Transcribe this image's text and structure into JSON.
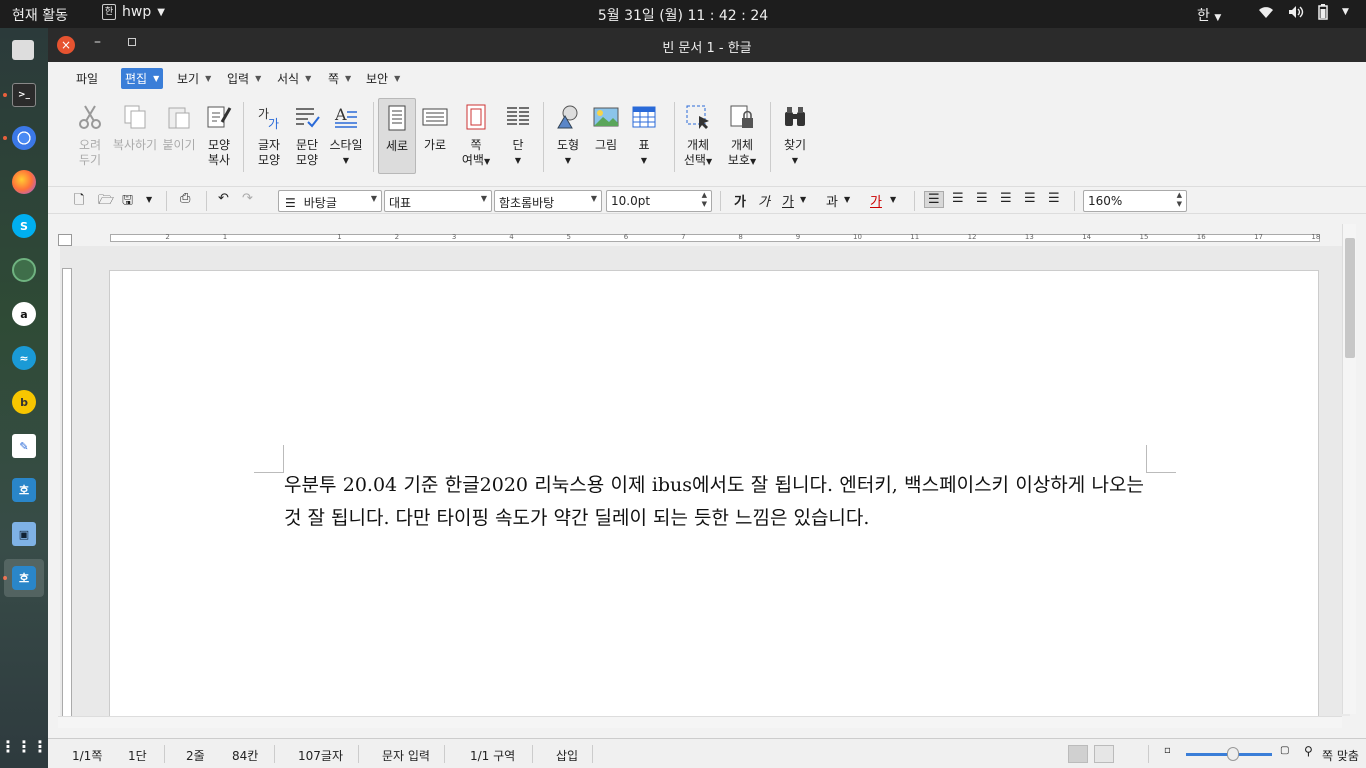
{
  "topbar": {
    "activities": "현재 활동",
    "app_name": "hwp",
    "app_icon": "한",
    "clock": "5월 31일 (월)  11 : 42 : 24",
    "ime": "한",
    "icons": [
      "wifi-icon",
      "volume-icon",
      "battery-icon",
      "power-menu-icon"
    ]
  },
  "dock": {
    "items": [
      "files",
      "terminal",
      "chrome",
      "firefox",
      "skype",
      "atom",
      "amazon",
      "app",
      "bandizip",
      "text-editor",
      "hancom-office",
      "virtualbox",
      "hwp"
    ],
    "show_apps_icon": "grid-icon"
  },
  "window": {
    "title": "빈 문서 1 - 한글",
    "close": "×",
    "minimize": "–"
  },
  "menu": {
    "items": [
      {
        "label": "파일"
      },
      {
        "label": "편집"
      },
      {
        "label": "보기"
      },
      {
        "label": "입력"
      },
      {
        "label": "서식"
      },
      {
        "label": "쪽"
      },
      {
        "label": "보안"
      }
    ]
  },
  "ribbon": {
    "cut": [
      "오려",
      "두기"
    ],
    "copy": "복사하기",
    "paste": "붙이기",
    "format_copy": [
      "모양",
      "복사"
    ],
    "char_shape": [
      "글자",
      "모양"
    ],
    "para_shape": [
      "문단",
      "모양"
    ],
    "style": "스타일",
    "portrait": "세로",
    "landscape": "가로",
    "page_margin": [
      "쪽",
      "여백"
    ],
    "columns": "단",
    "shape": "도형",
    "picture": "그림",
    "table": "표",
    "select_object": [
      "개체",
      "선택"
    ],
    "protect_object": [
      "개체",
      "보호"
    ],
    "find": "찾기"
  },
  "toolbar2": {
    "style_value": "바탕글",
    "lang_value": "대표",
    "font_value": "함초롬바탕",
    "size_value": "10.0pt",
    "bold": "가",
    "italic": "가",
    "underline": "가",
    "strike": "과",
    "color": "가",
    "zoom_value": "160%"
  },
  "ruler": {
    "ticks": [
      "2",
      "1",
      "1",
      "2",
      "3",
      "4",
      "5",
      "6",
      "7",
      "8",
      "9",
      "10",
      "11",
      "12",
      "13",
      "14",
      "15",
      "16",
      "17",
      "18"
    ]
  },
  "document": {
    "text": "우분투 20.04 기준 한글2020 리눅스용 이제 ibus에서도 잘 됩니다. 엔터키, 백스페이스키 이상하게 나오는 것 잘 됩니다. 다만 타이핑 속도가 약간 딜레이 되는 듯한 느낌은 있습니다."
  },
  "status": {
    "page": "1/1쪽",
    "column": "1단",
    "line": "2줄",
    "col_pos": "84칸",
    "chars": "107글자",
    "mode": "문자 입력",
    "section": "1/1 구역",
    "insert": "삽입",
    "fit": "쪽 맞춤"
  },
  "colors": {
    "accent": "#3a7ed8",
    "close": "#e65330",
    "topbar": "#1d1d1d",
    "titlebar": "#2b2b2b"
  }
}
